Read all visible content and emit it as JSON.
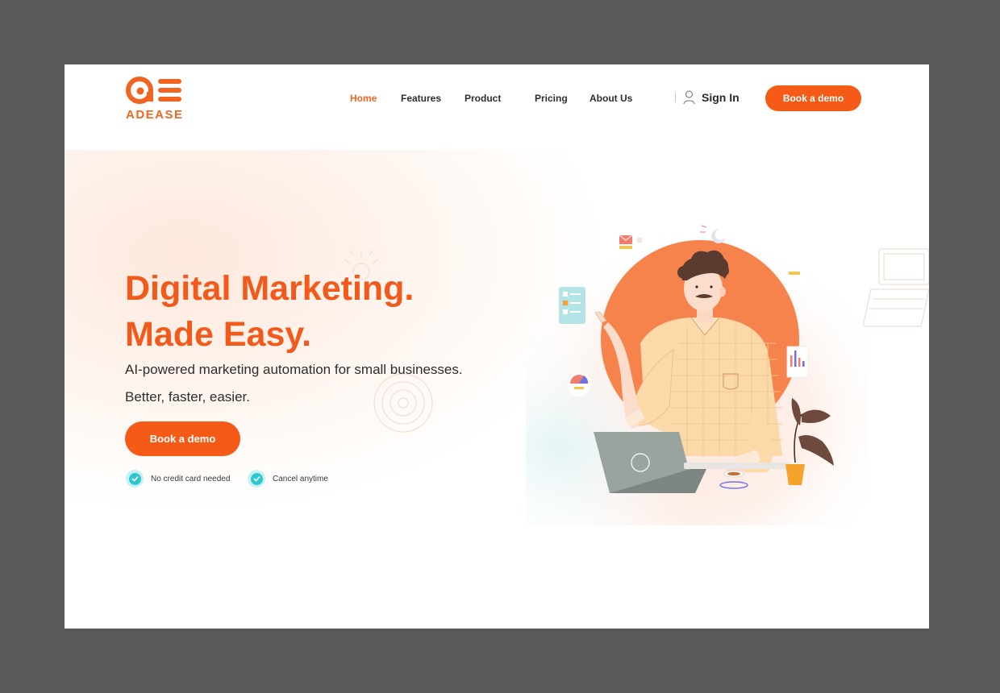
{
  "brand": {
    "name": "ADEASE",
    "color": "#f16522"
  },
  "nav": {
    "items": [
      {
        "label": "Home",
        "active": true
      },
      {
        "label": "Features",
        "active": false
      },
      {
        "label": "Product",
        "active": false
      },
      {
        "label": "Pricing",
        "active": false
      },
      {
        "label": "About Us",
        "active": false
      }
    ],
    "signin_label": "Sign In",
    "cta_label": "Book a demo"
  },
  "hero": {
    "title_line1": "Digital Marketing.",
    "title_line2": "Made Easy.",
    "subtitle_line1": "AI-powered marketing automation for small businesses.",
    "subtitle_line2": "Better, faster, easier.",
    "cta_label": "Book a demo",
    "perks": [
      "No credit card needed",
      "Cancel anytime"
    ]
  },
  "colors": {
    "accent": "#f55a17",
    "check": "#2fc6d0",
    "background": "#595959"
  }
}
